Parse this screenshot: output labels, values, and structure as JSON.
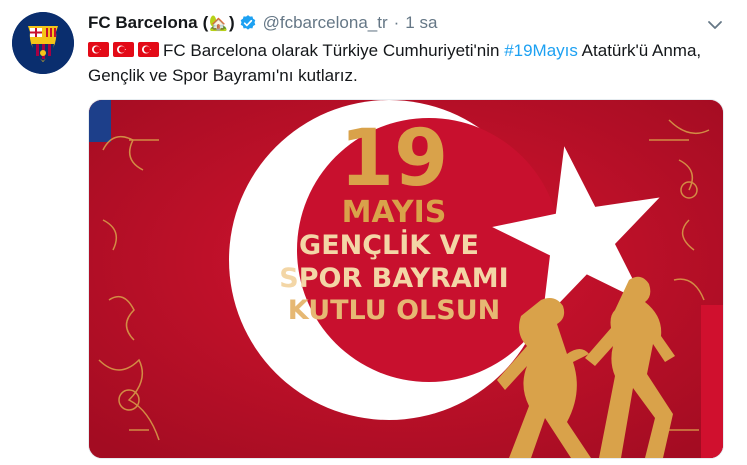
{
  "tweet": {
    "display_name": "FC Barcelona",
    "name_paren_open": "(",
    "name_emoji": "🏡",
    "name_paren_close": ")",
    "handle": "@fcbarcelona_tr",
    "separator": "·",
    "time": "1 sa",
    "text_part1": "FC Barcelona olarak Türkiye Cumhuriyeti'nin ",
    "hashtag": "#19Mayıs",
    "text_part2": " Atatürk'ü Anma, Gençlik ve Spor Bayramı'nı kutlarız.",
    "flag_count": 3,
    "icons": {
      "avatar": "fc-barcelona-crest",
      "verified": "verified-badge-icon",
      "menu": "chevron-down-icon",
      "flag": "turkey-flag-emoji"
    },
    "colors": {
      "hashtag": "#1da1f2",
      "muted": "#657786",
      "verified": "#1da1f2",
      "poster_red": "#c8102e",
      "poster_gold": "#d9a24a"
    }
  },
  "poster": {
    "line1": "19",
    "line2": "MAYIS",
    "line3": "GENÇLİK VE",
    "line4": "SPOR BAYRAMI",
    "line5": "KUTLU OLSUN"
  }
}
